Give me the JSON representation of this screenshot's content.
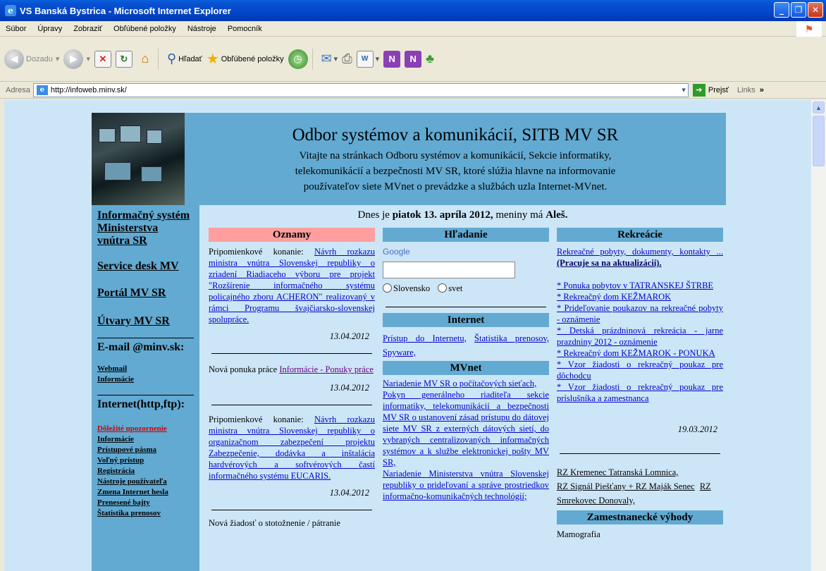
{
  "window": {
    "title": "VS Banská Bystrica - Microsoft Internet Explorer"
  },
  "menu": [
    "Súbor",
    "Úpravy",
    "Zobraziť",
    "Obľúbené položky",
    "Nástroje",
    "Pomocník"
  ],
  "toolbar": {
    "back": "Dozadu",
    "search": "Hľadať",
    "favorites": "Obľúbené položky"
  },
  "address": {
    "label": "Adresa",
    "url": "http://infoweb.minv.sk/",
    "go": "Prejsť",
    "links": "Links"
  },
  "banner": {
    "title": "Odbor systémov a komunikácií, SITB MV SR",
    "line1": "Vitajte na stránkach Odboru systémov a komunikácií, Sekcie informatiky,",
    "line2": "telekomunikácií a bezpečnosti MV SR, ktoré slúžia hlavne na informovanie",
    "line3": "používateľov siete MVnet o prevádzke a službách uzla Internet-MVnet."
  },
  "dateline": {
    "pre": "Dnes je ",
    "date": "piatok 13. apríla 2012,",
    "mid": " meniny má ",
    "name": "Aleš."
  },
  "sidebar": {
    "is1": "Informačný systém",
    "is2": "Ministerstva",
    "is3": "vnútra SR",
    "servicedesk": "Service desk MV",
    "portal": "Portál MV SR",
    "utvary": "Útvary MV SR",
    "email_hd": "E-mail @minv.sk:",
    "webmail": "Webmail",
    "info1": "Informácie",
    "internet_hd": "Internet(http,ftp):",
    "dolezite": "Dôležité upozornenie",
    "info2": "Informácie",
    "pristupove": "Prístupové pásma",
    "volny": "Voľný prístup",
    "registracia": "Registrácia",
    "nastroje": "Nástroje používateľa",
    "zmena": "Zmena Internet hesla",
    "prenesene": "Prenesené bajty",
    "statistika": "Štatistika prenosov"
  },
  "oznamy": {
    "header": "Oznamy",
    "n1_pre": "Pripomienkové konanie: ",
    "n1_link": "Návrh rozkazu ministra vnútra Slovenskej republiky o zriadení Riadiaceho výboru pre projekt \"Rozšírenie informačného systému policajného zboru ACHERON\" realizovaný v rámci Programu švajčiarsko-slovenskej spolupráce.",
    "n1_date": "13.04.2012",
    "n2_pre": "Nová ponuka práce ",
    "n2_link": "Informácie - Ponuky práce",
    "n2_date": "13.04.2012",
    "n3_pre": "Pripomienkové konanie: ",
    "n3_link": "Návrh rozkazu ministra vnútra Slovenskej republiky o organizačnom zabezpečení projektu Zabezpečenie, dodávka a inštalácia hardvérových a softvérových častí informačného systému EUCARIS.",
    "n3_date": "13.04.2012",
    "n4": "Nová žiadosť o stotožnenie / pátranie"
  },
  "hladanie": {
    "header": "Hľadanie",
    "google": "Google",
    "opt1": "Slovensko",
    "opt2": "svet"
  },
  "internet": {
    "header": "Internet",
    "l1": "Prístup do Internetu,",
    "l2": "Štatistika prenosov,",
    "l3": "Spyware,"
  },
  "mvnet": {
    "header": "MVnet",
    "l1": "Nariadenie MV SR o počítačových sieťach,",
    "l2": "Pokyn generálneho riaditeľa sekcie informatiky, telekomunikácií a bezpečnosti MV SR o ustanovení zásad prístupu do dátovej siete MV SR z externých dátových sietí, do vybraných centralizovaných informačných systémov a k službe elektronickej pošty MV SR,",
    "l3": "Nariadenie Ministerstva vnútra Slovenskej republiky o prideľovaní a správe prostriedkov informačno-komunikačných technológií;"
  },
  "rekreacie": {
    "header": "Rekreácie",
    "l1": "Rekreačné pobyty, dokumenty, kontakty ... ",
    "l1b": "(Pracuje sa na aktualizácii).",
    "r1": "* Ponuka pobytov v TATRANSKEJ ŠTRBE",
    "r2": "* Rekreačný dom KEŽMAROK",
    "r3": "* Prideľovanie poukazov na rekreačné pobyty - oznámenie",
    "r4": "* Detská prázdninová rekreácia - jarne prazdniny 2012 - oznámenie",
    "r5": "* Rekreačný dom KEŽMAROK - PONUKA",
    "b1": "* Vzor žiadosti o rekreačný poukaz pre dôchodcu",
    "b2": "* Vzor žiadosti o rekreačný poukaz pre príslušníka a zamestnanca",
    "date": "19.03.2012",
    "rz1": "RZ Kremenec Tatranská Lomnica,",
    "rz2": "RZ Signál Piešťany + RZ Maják Senec",
    "rz3": "RZ Smrekovec Donovaly,",
    "zam_header": "Zamestnanecké výhody",
    "memo": "Mamografia"
  }
}
